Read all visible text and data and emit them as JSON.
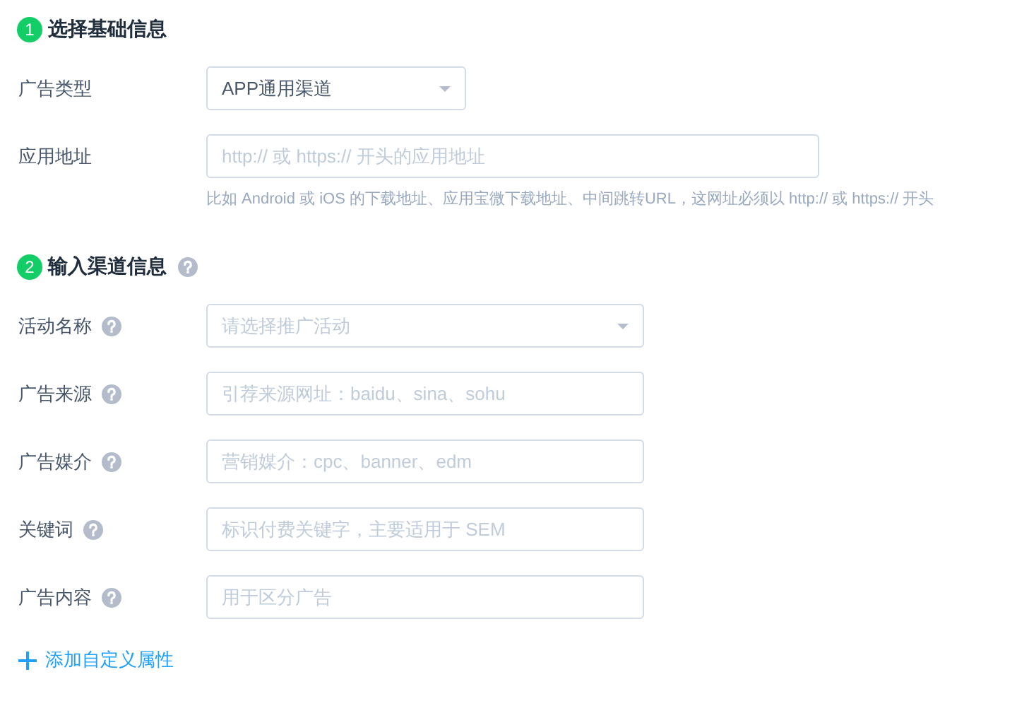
{
  "sections": [
    {
      "step": "1",
      "title": "选择基础信息",
      "help": false,
      "fields": [
        {
          "kind": "select",
          "label": "广告类型",
          "help": false,
          "value": "APP通用渠道"
        },
        {
          "kind": "input",
          "label": "应用地址",
          "help": false,
          "placeholder": "http:// 或 https:// 开头的应用地址",
          "hint": "比如 Android 或 iOS 的下载地址、应用宝微下载地址、中间跳转URL，这网址必须以 http:// 或 https:// 开头"
        }
      ]
    },
    {
      "step": "2",
      "title": "输入渠道信息",
      "help": true,
      "fields": [
        {
          "kind": "select",
          "label": "活动名称",
          "help": true,
          "placeholder": "请选择推广活动"
        },
        {
          "kind": "input",
          "label": "广告来源",
          "help": true,
          "placeholder": "引荐来源网址：baidu、sina、sohu"
        },
        {
          "kind": "input",
          "label": "广告媒介",
          "help": true,
          "placeholder": "营销媒介：cpc、banner、edm"
        },
        {
          "kind": "input",
          "label": "关键词",
          "help": true,
          "placeholder": "标识付费关键字，主要适用于 SEM"
        },
        {
          "kind": "input",
          "label": "广告内容",
          "help": true,
          "placeholder": "用于区分广告"
        }
      ]
    }
  ],
  "add_link": "添加自定义属性"
}
